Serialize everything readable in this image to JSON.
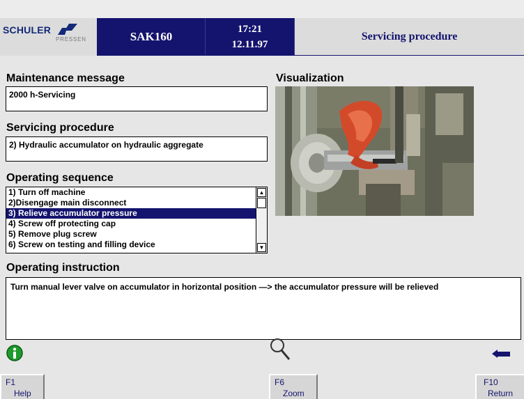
{
  "header": {
    "logo_text": "SCHULER",
    "logo_sub": "PRESSEN",
    "press_name": "SAK160",
    "time": "17:21",
    "date": "12.11.97",
    "screen_title": "Servicing procedure"
  },
  "maintenance": {
    "label": "Maintenance message",
    "value": "2000 h-Servicing"
  },
  "servicing": {
    "label": "Servicing procedure",
    "value": "2) Hydraulic accumulator on hydraulic aggregate"
  },
  "sequence": {
    "label": "Operating sequence",
    "items": [
      "1) Turn off machine",
      "2)Disengage main disconnect",
      "3) Relieve accumulator pressure",
      "4) Screw off protecting cap",
      "5) Remove plug screw",
      "6) Screw on testing and filling device"
    ],
    "selected_index": 2
  },
  "visualization": {
    "label": "Visualization"
  },
  "instruction": {
    "label": "Operating instruction",
    "text": "Turn manual lever valve on accumulator in horizontal position —> the accumulator pressure will be relieved"
  },
  "icons": {
    "info": "info-icon",
    "zoom": "magnifier-icon",
    "return": "return-arrow-icon"
  },
  "fkeys": {
    "f1": {
      "key": "F1",
      "label": "Help"
    },
    "f6": {
      "key": "F6",
      "label": "Zoom"
    },
    "f10": {
      "key": "F10",
      "label": "Return"
    }
  },
  "colors": {
    "header_navy": "#14146e",
    "selection": "#14146e",
    "info_green": "#1e9a2e",
    "background": "#e6e6e6"
  }
}
